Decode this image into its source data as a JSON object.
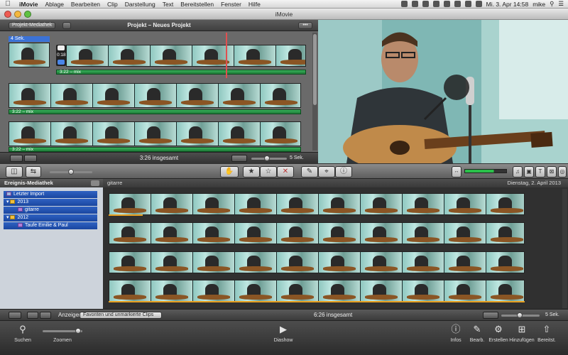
{
  "menubar": {
    "apple": "",
    "items": [
      "iMovie",
      "Ablage",
      "Bearbeiten",
      "Clip",
      "Darstellung",
      "Text",
      "Bereitstellen",
      "Fenster",
      "Hilfe"
    ],
    "clock": "Mi. 3. Apr 14:58",
    "user": "mike"
  },
  "window": {
    "title": "iMovie"
  },
  "project": {
    "library_button": "Projekt-Mediathek",
    "title": "Projekt – Neues Projekt",
    "clip_duration": "4 Sek.",
    "clip_time": "0:18",
    "audio_label": "3:22 – mix",
    "total": "3:26 insgesamt",
    "zoom_label": "5 Sek."
  },
  "library": {
    "header": "Ereignis-Mediathek",
    "items": [
      "Letzter Import",
      "2013",
      "gitarre",
      "2012",
      "Taufe Emilie & Paul"
    ]
  },
  "browser": {
    "event_name": "gitarre",
    "date": "Dienstag, 2. April 2013"
  },
  "footer": {
    "show_label": "Anzeigen:",
    "filter_value": "Favoriten und unmarkierte Clips",
    "total": "6:26 insgesamt",
    "zoom_label": "5 Sek."
  },
  "dock": {
    "search": "Suchen",
    "zoom": "Zoomen",
    "slideshow": "Diashow",
    "info": "Infos",
    "edit": "Bearb.",
    "create": "Erstellen",
    "add": "Hinzufügen",
    "share": "Bereitst."
  }
}
